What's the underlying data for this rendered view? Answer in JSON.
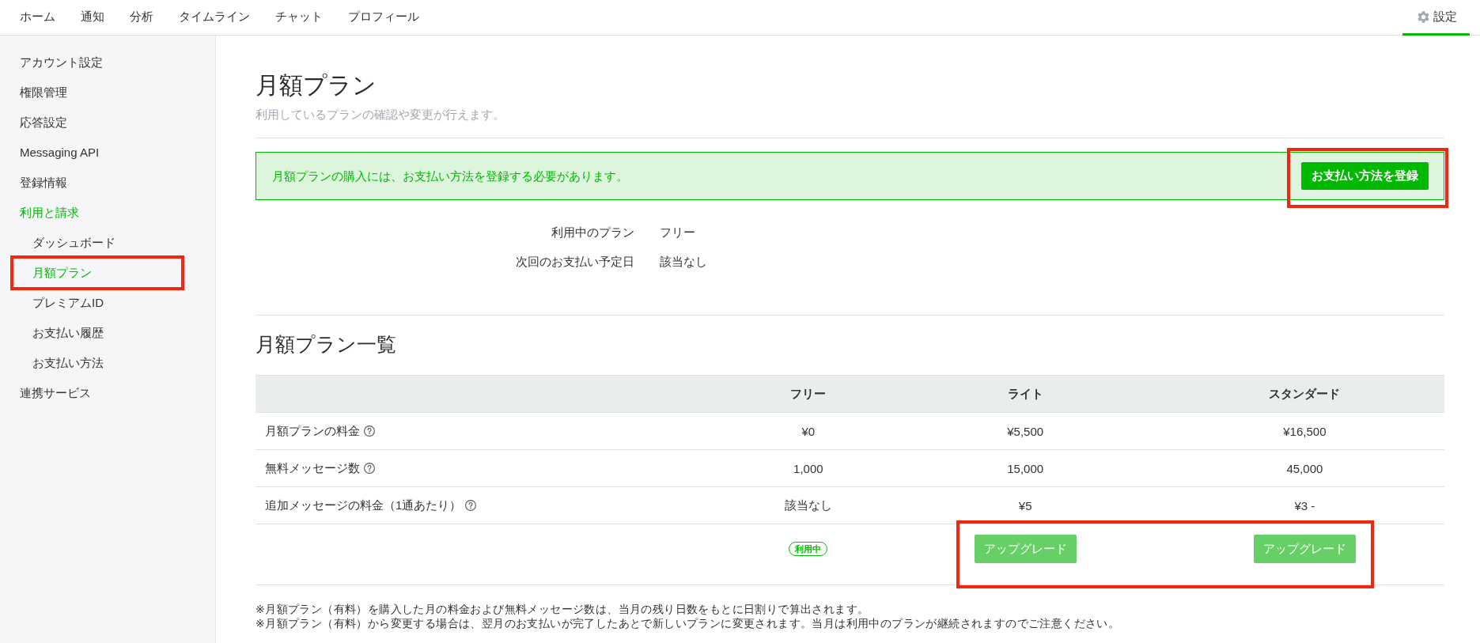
{
  "nav": {
    "tabs": [
      {
        "label": "ホーム",
        "selected": false
      },
      {
        "label": "通知",
        "selected": false
      },
      {
        "label": "分析",
        "selected": false
      },
      {
        "label": "タイムライン",
        "selected": false
      },
      {
        "label": "チャット",
        "selected": false
      },
      {
        "label": "プロフィール",
        "selected": false
      }
    ],
    "settings": {
      "label": "設定",
      "selected": true
    }
  },
  "sidebar": {
    "items": [
      {
        "label": "アカウント設定",
        "selected": false,
        "highlighted": false
      },
      {
        "label": "権限管理",
        "selected": false,
        "highlighted": false
      },
      {
        "label": "応答設定",
        "selected": false,
        "highlighted": false
      },
      {
        "label": "Messaging API",
        "selected": false,
        "highlighted": false
      },
      {
        "label": "登録情報",
        "selected": false,
        "highlighted": false
      },
      {
        "label": "利用と請求",
        "selected": true,
        "highlighted": false,
        "children": [
          {
            "label": "ダッシュボード",
            "selected": false,
            "highlighted": false
          },
          {
            "label": "月額プラン",
            "selected": true,
            "highlighted": true
          },
          {
            "label": "プレミアムID",
            "selected": false,
            "highlighted": false
          },
          {
            "label": "お支払い履歴",
            "selected": false,
            "highlighted": false
          },
          {
            "label": "お支払い方法",
            "selected": false,
            "highlighted": false
          }
        ]
      },
      {
        "label": "連携サービス",
        "selected": false,
        "highlighted": false
      }
    ]
  },
  "page": {
    "title": "月額プラン",
    "subtitle": "利用しているプランの確認や変更が行えます。"
  },
  "notice": {
    "message": "月額プランの購入には、お支払い方法を登録する必要があります。",
    "button": {
      "label": "お支払い方法を登録",
      "highlighted": true
    }
  },
  "current_plan": [
    {
      "label": "利用中のプラン",
      "value": "フリー"
    },
    {
      "label": "次回のお支払い予定日",
      "value": "該当なし"
    }
  ],
  "plan_table": {
    "title": "月額プラン一覧",
    "columns": [
      "フリー",
      "ライト",
      "スタンダード"
    ],
    "rows": [
      {
        "label": "月額プランの料金",
        "help": true,
        "values": [
          "¥0",
          "¥5,500",
          "¥16,500"
        ]
      },
      {
        "label": "無料メッセージ数",
        "help": true,
        "values": [
          "1,000",
          "15,000",
          "45,000"
        ]
      },
      {
        "label": "追加メッセージの料金（1通あたり）",
        "help": true,
        "values": [
          "該当なし",
          "¥5",
          "¥3 -"
        ]
      }
    ],
    "actions": [
      {
        "kind": "badge",
        "label": "利用中",
        "highlighted": false
      },
      {
        "kind": "button",
        "label": "アップグレード",
        "disabled": true,
        "highlighted": true
      },
      {
        "kind": "button",
        "label": "アップグレード",
        "disabled": true,
        "highlighted": true
      }
    ]
  },
  "notes": [
    "※月額プラン（有料）を購入した月の料金および無料メッセージ数は、当月の残り日数をもとに日割りで算出されます。",
    "※月額プラン（有料）から変更する場合は、翌月のお支払いが完了したあとで新しいプランに変更されます。当月は利用中のプランが継続されますのでご注意ください。"
  ]
}
